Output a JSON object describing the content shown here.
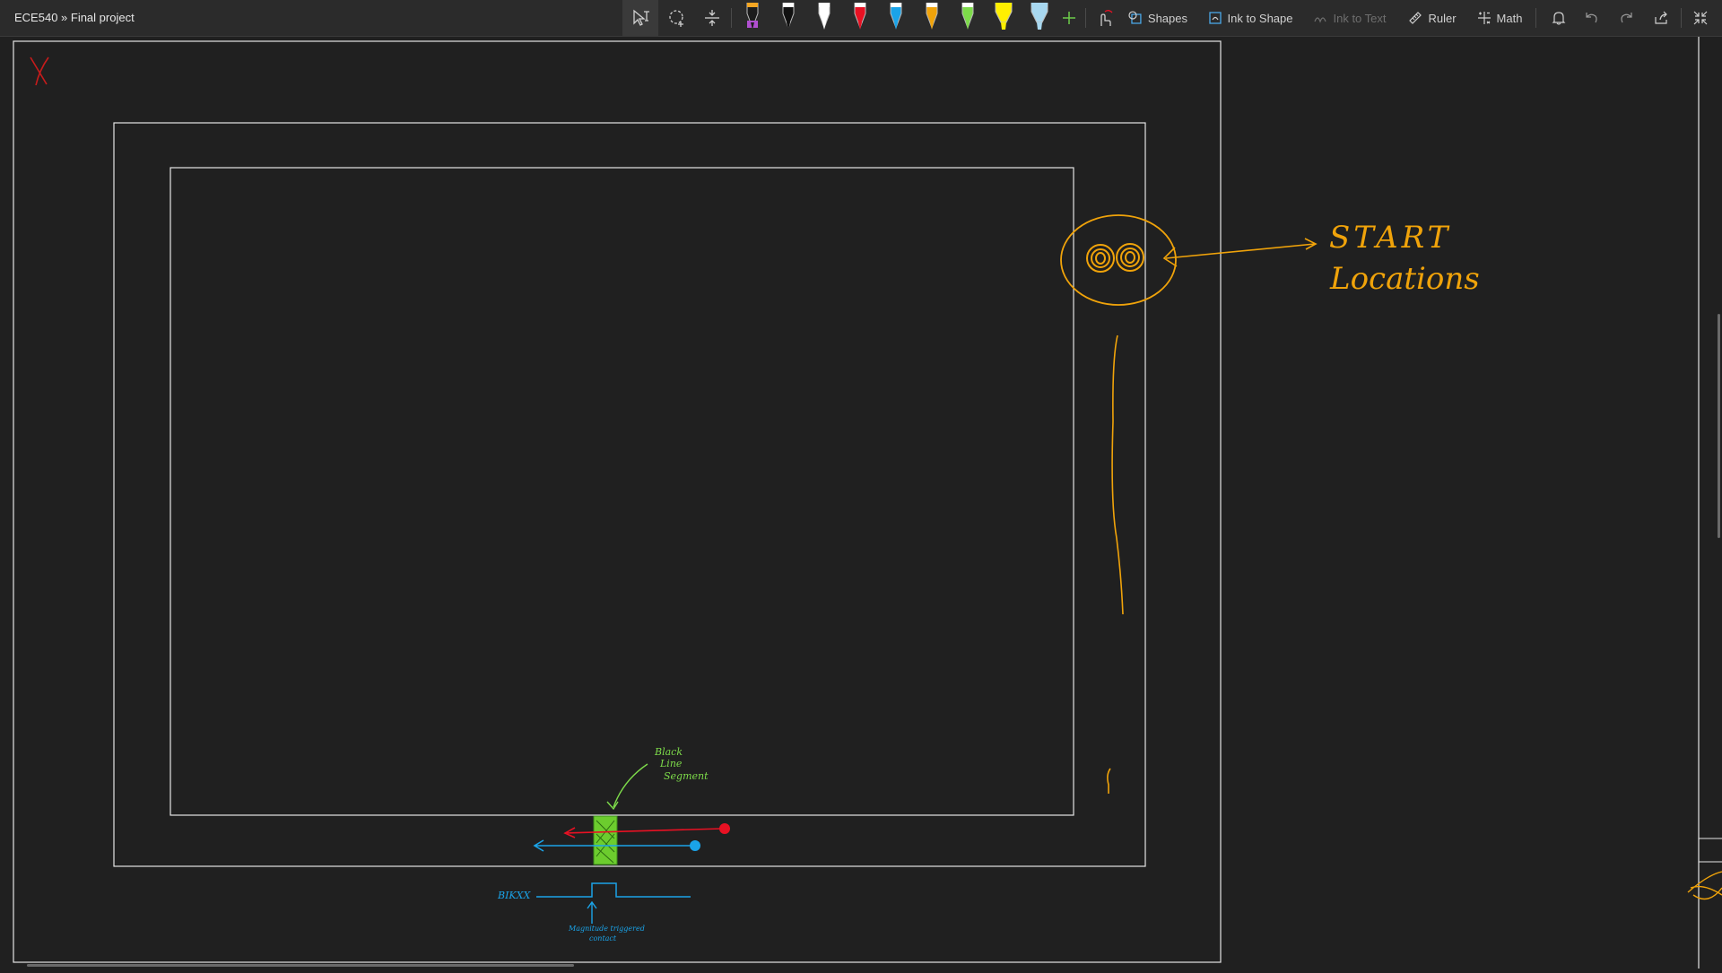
{
  "breadcrumb": "ECE540 » Final project",
  "toolbar": {
    "tools": [
      {
        "name": "type-select-tool",
        "icon": "cursor-text-icon"
      },
      {
        "name": "lasso-select-tool",
        "icon": "lasso-icon"
      },
      {
        "name": "add-space-tool",
        "icon": "insert-space-icon"
      }
    ],
    "pens": [
      {
        "name": "pen-black-purple",
        "tip": "#1c1c1c",
        "band": "#b04fd0",
        "cap": "#f5a623"
      },
      {
        "name": "pen-black",
        "tip": "#111111",
        "band": "#111111",
        "cap": "#ffffff"
      },
      {
        "name": "pen-white",
        "tip": "#ffffff",
        "band": "#ffffff",
        "cap": "#ffffff"
      },
      {
        "name": "pen-red",
        "tip": "#e81123",
        "band": "#e81123",
        "cap": "#ffffff"
      },
      {
        "name": "pen-blue",
        "tip": "#1aa3e8",
        "band": "#1aa3e8",
        "cap": "#ffffff"
      },
      {
        "name": "pen-orange",
        "tip": "#f0a30a",
        "band": "#f0a30a",
        "cap": "#ffffff"
      },
      {
        "name": "pen-green",
        "tip": "#7ddb4a",
        "band": "#7ddb4a",
        "cap": "#ffffff"
      },
      {
        "name": "highlighter-yellow",
        "tip": "#ffef00",
        "band": "#ffef00",
        "cap": "#ffef00"
      },
      {
        "name": "highlighter-lightblue",
        "tip": "#a8d8f0",
        "band": "#a8d8f0",
        "cap": "#a8d8f0"
      }
    ],
    "add_pen_icon": "plus-icon",
    "touch_draw_icon": "touch-writing-icon",
    "shapes_label": "Shapes",
    "ink_to_shape_label": "Ink to Shape",
    "ink_to_text_label": "Ink to Text",
    "ruler_label": "Ruler",
    "math_label": "Math",
    "right_icons": [
      "bell-icon",
      "undo-icon",
      "redo-icon",
      "share-icon",
      "collapse-icon"
    ]
  },
  "canvas": {
    "annotations": {
      "start_line1": "START",
      "start_line2": "Locations",
      "black_line_1": "Black",
      "black_line_2": "Line",
      "black_line_3": "Segment",
      "blk_label": "BIKXX",
      "bottom_note_1": "Magnitude triggered",
      "bottom_note_2": "contact"
    },
    "colors": {
      "frame": "#e6e6e6",
      "orange_ink": "#f0a30a",
      "red_ink": "#e81123",
      "blue_ink": "#1aa3e8",
      "green_ink": "#7ddb4a"
    }
  }
}
